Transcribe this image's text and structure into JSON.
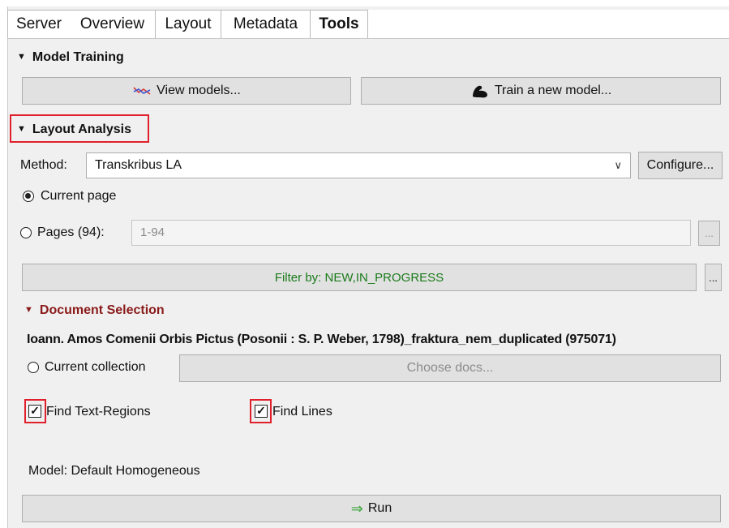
{
  "tabs": [
    "Server",
    "Overview",
    "Layout",
    "Metadata",
    "Tools"
  ],
  "active_tab": "Tools",
  "model_training": {
    "title": "Model Training",
    "view_models_label": "View models...",
    "train_model_label": "Train a new model..."
  },
  "layout_analysis": {
    "title": "Layout Analysis",
    "method_label": "Method:",
    "method_value": "Transkribus LA",
    "configure_label": "Configure...",
    "current_page_label": "Current page",
    "current_page_selected": true,
    "pages_label": "Pages (94):",
    "pages_value": "1-94",
    "pages_more_label": "...",
    "filter_label": "Filter by: NEW,IN_PROGRESS",
    "filter_more_label": "..."
  },
  "document_selection": {
    "title": "Document Selection",
    "document_name": "Ioann. Amos Comenii Orbis Pictus (Posonii : S. P. Weber, 1798)_fraktura_nem_duplicated (975071)",
    "current_collection_label": "Current collection",
    "choose_docs_label": "Choose docs..."
  },
  "options": {
    "find_text_regions_label": "Find Text-Regions",
    "find_text_regions_checked": true,
    "find_lines_label": "Find Lines",
    "find_lines_checked": true,
    "check_mark": "✓"
  },
  "model_label": "Model: Default Homogeneous",
  "run_label": "Run",
  "run_icon": "⇒",
  "colors": {
    "highlight_red": "#e0202c",
    "doc_selection_title": "#8b1a1a",
    "filter_text": "#1a7a1a",
    "run_arrow": "#3aa63a"
  }
}
